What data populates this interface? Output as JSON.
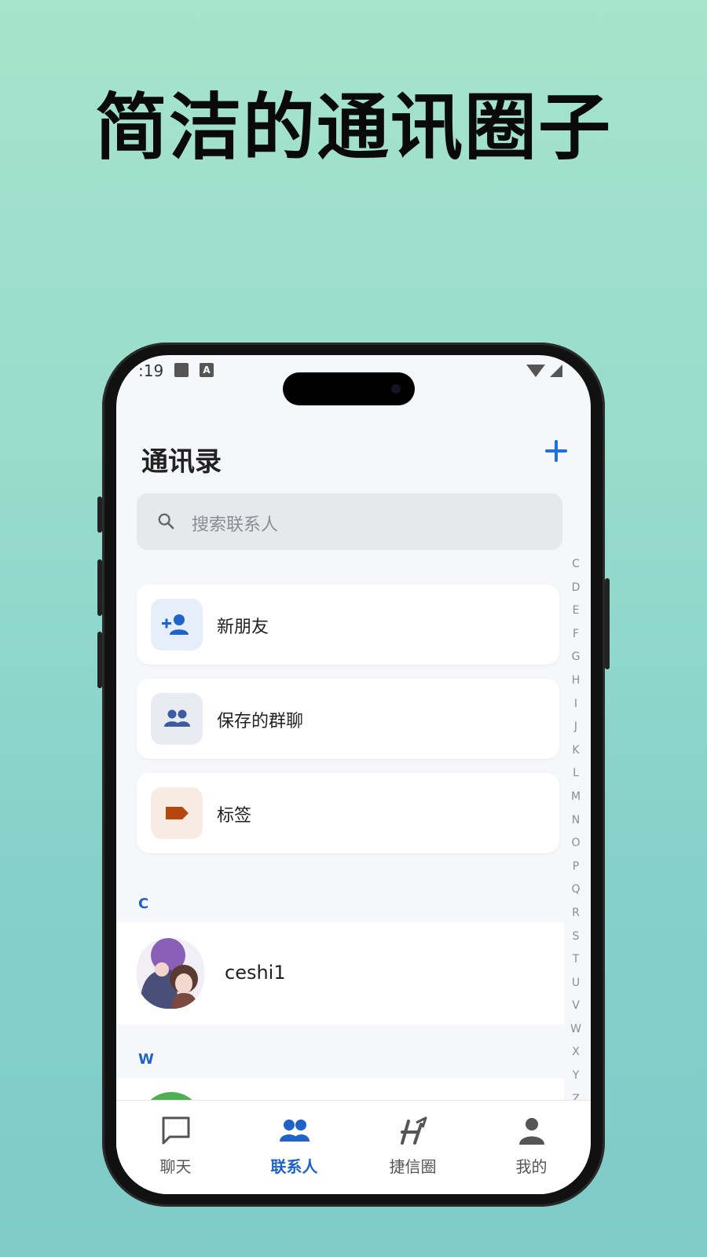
{
  "headline": "简洁的通讯圈子",
  "status_bar": {
    "time": ":19",
    "icon_a": "A"
  },
  "header": {
    "title": "通讯录",
    "add_icon": "plus-icon"
  },
  "search": {
    "placeholder": "搜索联系人"
  },
  "quick_actions": [
    {
      "label": "新朋友",
      "icon": "add-person-icon",
      "color": "#1f63c8"
    },
    {
      "label": "保存的群聊",
      "icon": "group-icon",
      "color": "#3a5ba0"
    },
    {
      "label": "标签",
      "icon": "tag-icon",
      "color": "#b5470c"
    }
  ],
  "alphabet_index": [
    "C",
    "D",
    "E",
    "F",
    "G",
    "H",
    "I",
    "J",
    "K",
    "L",
    "M",
    "N",
    "O",
    "P",
    "Q",
    "R",
    "S",
    "T",
    "U",
    "V",
    "W",
    "X",
    "Y",
    "Z"
  ],
  "sections": [
    {
      "letter": "C",
      "contacts": [
        {
          "name": "ceshi1"
        }
      ]
    },
    {
      "letter": "W",
      "contacts": []
    }
  ],
  "tabbar": [
    {
      "label": "聊天",
      "icon": "chat-icon",
      "active": false
    },
    {
      "label": "联系人",
      "icon": "contacts-icon",
      "active": true
    },
    {
      "label": "捷信圈",
      "icon": "moments-logo-icon",
      "active": false
    },
    {
      "label": "我的",
      "icon": "profile-icon",
      "active": false
    }
  ],
  "colors": {
    "accent": "#1f63c8",
    "background_top": "#a6e4cc",
    "background_bottom": "#7fcbc8"
  }
}
